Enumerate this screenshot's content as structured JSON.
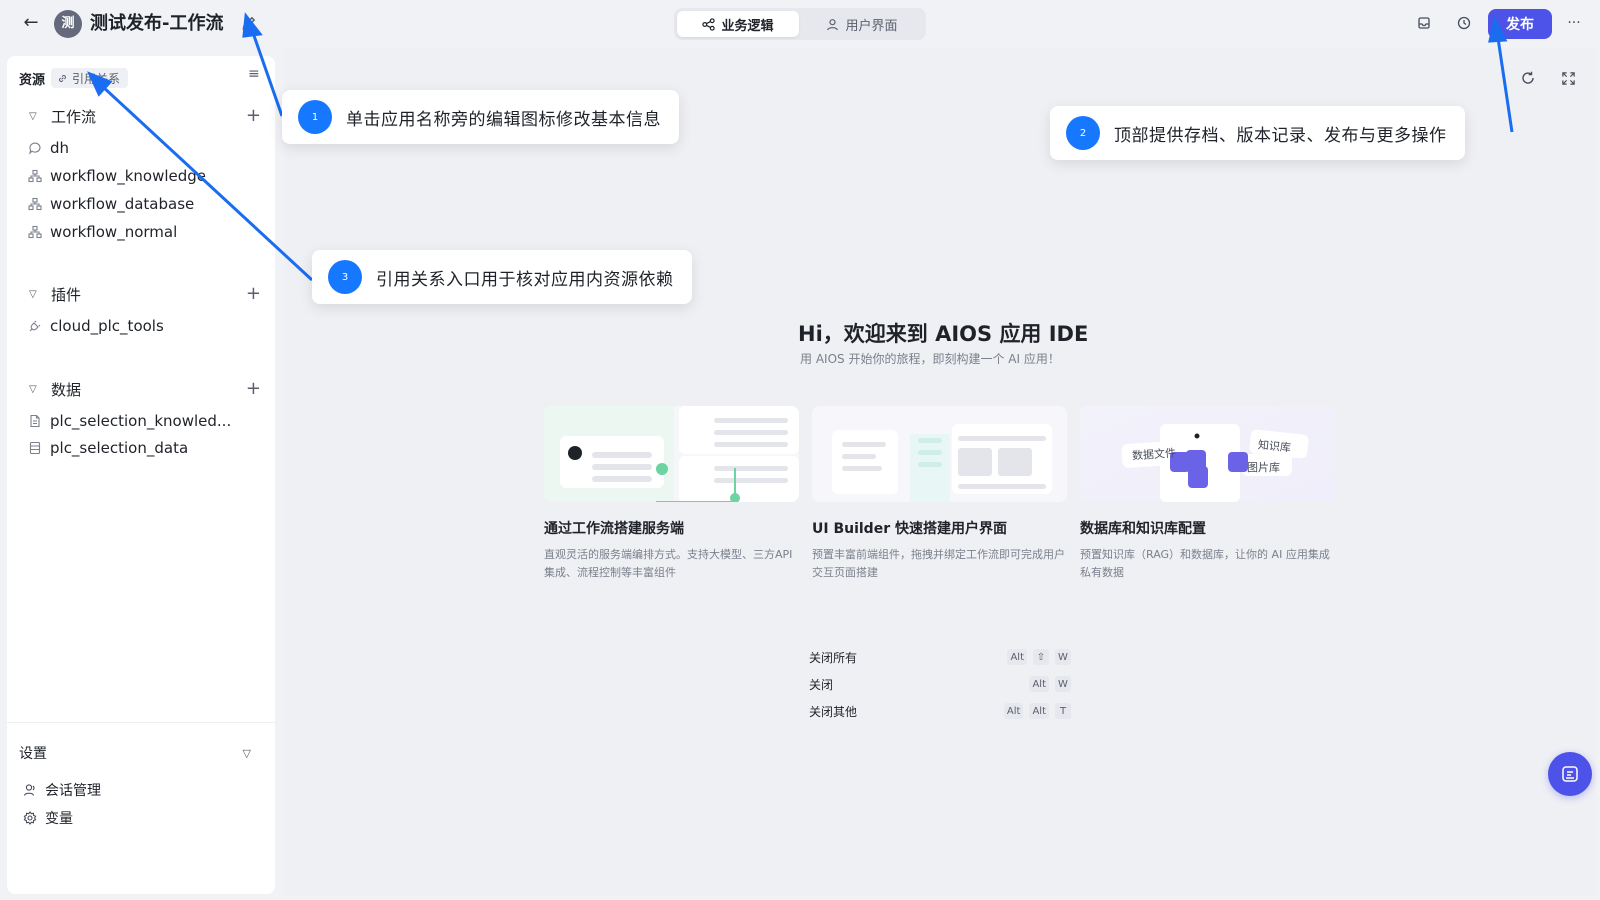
{
  "header": {
    "back_label": "←",
    "app_avatar": "测",
    "app_title": "测试发布-工作流",
    "tabs": [
      {
        "label": "业务逻辑",
        "icon": "share-icon",
        "active": true
      },
      {
        "label": "用户界面",
        "icon": "user-icon",
        "active": false
      }
    ],
    "publish_label": "发布",
    "more_label": "···"
  },
  "sidebar": {
    "resources_label": "资源",
    "references_label": "引用关系",
    "menu_label": "≡",
    "sections": [
      {
        "title": "工作流",
        "items": [
          {
            "label": "dh",
            "icon": "chat-icon"
          },
          {
            "label": "workflow_knowledge",
            "icon": "workflow-icon"
          },
          {
            "label": "workflow_database",
            "icon": "workflow-icon"
          },
          {
            "label": "workflow_normal",
            "icon": "workflow-icon"
          }
        ]
      },
      {
        "title": "插件",
        "items": [
          {
            "label": "cloud_plc_tools",
            "icon": "plugin-icon"
          }
        ]
      },
      {
        "title": "数据",
        "items": [
          {
            "label": "plc_selection_knowled...",
            "icon": "document-icon"
          },
          {
            "label": "plc_selection_data",
            "icon": "database-icon"
          }
        ]
      }
    ],
    "settings": {
      "title": "设置",
      "items": [
        {
          "label": "会话管理",
          "icon": "conversation-icon"
        },
        {
          "label": "变量",
          "icon": "gear-icon"
        }
      ]
    }
  },
  "main": {
    "welcome_title": "Hi，欢迎来到 AIOS 应用 IDE",
    "welcome_subtitle": "用 AIOS 开始你的旅程，即刻构建一个 AI 应用！",
    "cards": [
      {
        "title": "通过工作流搭建服务端",
        "desc": "直观灵活的服务端编排方式。支持大模型、三方API集成、流程控制等丰富组件"
      },
      {
        "title": "UI Builder 快速搭建用户界面",
        "desc": "预置丰富前端组件，拖拽并绑定工作流即可完成用户交互页面搭建"
      },
      {
        "title": "数据库和知识库配置",
        "desc": "预置知识库（RAG）和数据库，让你的 AI 应用集成私有数据"
      }
    ],
    "card3_tags": {
      "data_file": "数据文件",
      "knowledge_base": "知识库",
      "image_lib": "图片库"
    },
    "shortcuts": [
      {
        "name": "关闭所有",
        "keys": [
          "Alt",
          "⇧",
          "W"
        ]
      },
      {
        "name": "关闭",
        "keys": [
          "Alt",
          "W"
        ]
      },
      {
        "name": "关闭其他",
        "keys": [
          "Alt",
          "Alt",
          "T"
        ]
      }
    ]
  },
  "annotations": [
    {
      "num": "1",
      "text": "单击应用名称旁的编辑图标修改基本信息"
    },
    {
      "num": "2",
      "text": "顶部提供存档、版本记录、发布与更多操作"
    },
    {
      "num": "3",
      "text": "引用关系入口用于核对应用内资源依赖"
    }
  ],
  "colors": {
    "accent": "#4d53e8",
    "annotation": "#1677ff"
  }
}
